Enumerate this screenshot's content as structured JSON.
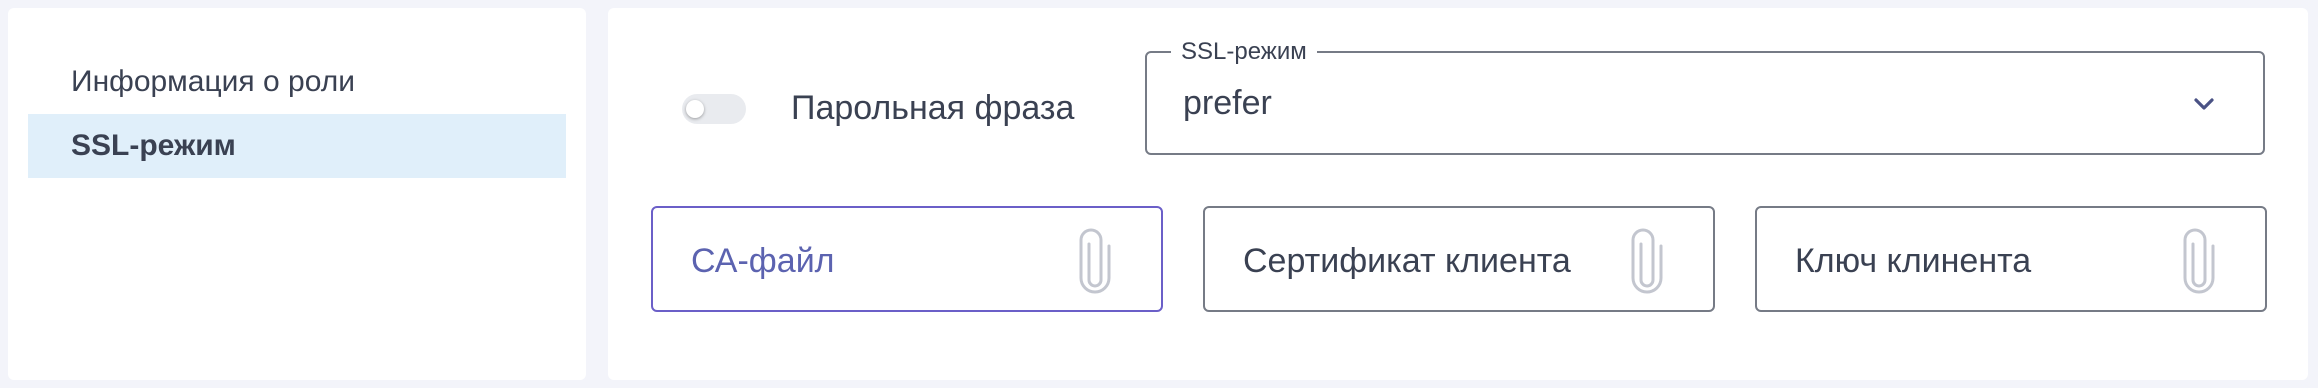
{
  "sidebar": {
    "items": [
      {
        "label": "Информация о роли",
        "selected": false
      },
      {
        "label": "SSL-режим",
        "selected": true
      }
    ]
  },
  "main": {
    "passphrase_toggle": {
      "label": "Парольная фраза",
      "on": false
    },
    "ssl_mode": {
      "legend": "SSL-режим",
      "value": "prefer",
      "icon": "chevron-down-icon"
    },
    "files": [
      {
        "label": "СА-файл",
        "icon": "paperclip-icon",
        "focused": true
      },
      {
        "label": "Сертификат клиента",
        "icon": "paperclip-icon",
        "focused": false
      },
      {
        "label": "Ключ клинента",
        "icon": "paperclip-icon",
        "focused": false
      }
    ]
  },
  "colors": {
    "selected_bg": "#e0effa",
    "accent": "#6b5fc8",
    "accent_text": "#5c63b0",
    "border": "#767b86",
    "icon": "#c3c6cf"
  }
}
